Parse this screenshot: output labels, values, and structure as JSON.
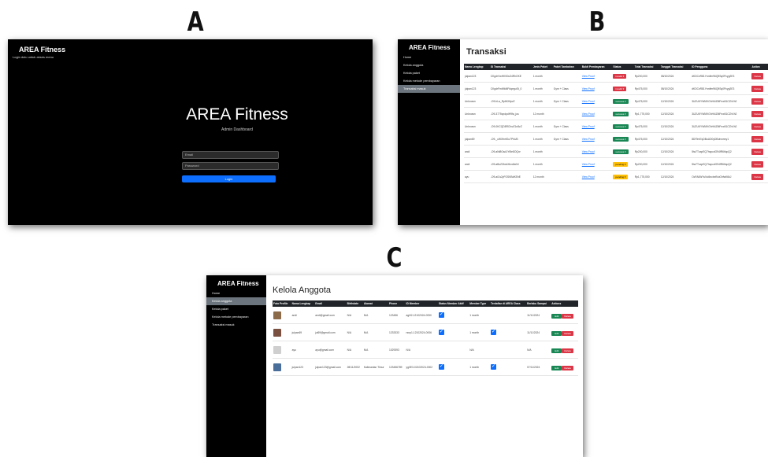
{
  "labels": {
    "a": "A",
    "b": "B",
    "c": "C"
  },
  "login": {
    "brand": "AREA Fitness",
    "subtitle": "Login dulu untuk akses menu",
    "big_title": "AREA Fitness",
    "dashboard": "Admin Dashboard",
    "email_placeholder": "Email",
    "password_placeholder": "Password",
    "login_label": "Login"
  },
  "sidebar": {
    "brand": "AREA Fitness",
    "items": [
      "Home",
      "Kelola anggota",
      "Kelola paket",
      "Kelola metode pembayaran",
      "Transaksi masuk"
    ]
  },
  "transaksi": {
    "title": "Transaksi",
    "columns": [
      "Nama Lengkap",
      "ID Transaksi",
      "Jenis Paket",
      "Paket Tambahan",
      "Bukti Pembayaran",
      "Status",
      "Total Transaksi",
      "Tanggal Transaksi",
      "ID Pengguna",
      "Action"
    ],
    "rows": [
      {
        "nama": "julpan123",
        "id": "CKgdrVwHKS0u34RhOKE",
        "paket": "1 month",
        "tambahan": "",
        "bukti": "View Proof",
        "status": "invalid",
        "total": "Rp200,000",
        "tanggal": "08/10/2024",
        "uid": "dKDCxR81Yrvdfm96Q9Sq0Pcyg2E3",
        "action": "Delete"
      },
      {
        "nama": "julpan123",
        "id": "CKgdrFmWkMFdqeguSt_0",
        "paket": "1 month",
        "tambahan": "Gym + Class",
        "bukti": "View Proof",
        "status": "invalid",
        "total": "Rp475,000",
        "tanggal": "08/10/2024",
        "uid": "dKDCxR81Yrvdfm96Q9Sq0Pcyg2E3",
        "action": "Delete"
      },
      {
        "nama": "Unknown",
        "id": "-O9-hLa_Rp6KHlpvZ",
        "paket": "1 month",
        "tambahan": "Gym + Class",
        "bukti": "View Proof",
        "status": "success",
        "total": "Rp475,000",
        "tanggal": "12/10/2024",
        "uid": "3UZUKYWMXGhHi4ZMFnw51CZhXh2",
        "action": "Delete"
      },
      {
        "nama": "Unknown",
        "id": "-O9-3775vpdpdH9fa_jus",
        "paket": "12 month",
        "tambahan": "",
        "bukti": "View Proof",
        "status": "success",
        "total": "Rp1,775,000",
        "tanggal": "12/10/2024",
        "uid": "3UZUKYWMXGhHi4ZMFnw51CZhXh2",
        "action": "Delete"
      },
      {
        "nama": "Unknown",
        "id": "-O9-0KCQD8RCfxvZ1n8zZ",
        "paket": "1 month",
        "tambahan": "Gym + Class",
        "bukti": "View Proof",
        "status": "success",
        "total": "Rp475,000",
        "tanggal": "12/10/2024",
        "uid": "3UZUKYWMXGhHi4ZMFnw51CZhXh2",
        "action": "Delete"
      },
      {
        "nama": "julpan69",
        "id": "-O9-_cWXfnrfGc7PhUB",
        "paket": "1 month",
        "tambahan": "Gym + Class",
        "bukti": "View Proof",
        "status": "success",
        "total": "Rp475,000",
        "tanggal": "12/10/2024",
        "uid": "8DfTeb7qDBuUD0yDBotvnmry1",
        "action": "Delete"
      },
      {
        "nama": "andi",
        "id": "-O9-aNt8Gsd1Yt5e8OQxr",
        "paket": "1 month",
        "tambahan": "",
        "bukti": "View Proof",
        "status": "success",
        "total": "Rp200,000",
        "tanggal": "12/10/2024",
        "uid": "5iw7TuxpEQ7hspcdO94fR6ifupQ2",
        "action": "Delete"
      },
      {
        "nama": "andi",
        "id": "-O9-aBcZZbxkXbxdbxNI",
        "paket": "1 month",
        "tambahan": "",
        "bukti": "View Proof",
        "status": "pending",
        "total": "Rp200,000",
        "tanggal": "12/10/2024",
        "uid": "5iw7TuxpEQ7hspcdO94fR6ifupQ2",
        "action": "Delete"
      },
      {
        "nama": "ayu",
        "id": "-O9-aiCs2yFOSKBdKEbE",
        "paket": "12 month",
        "tambahan": "",
        "bukti": "View Proof",
        "status": "pending",
        "total": "Rp1,775,000",
        "tanggal": "12/10/2024",
        "uid": "OcFA6WYuNo5ncbxfNoGhfwK6kJ",
        "action": "Delete"
      }
    ]
  },
  "anggota": {
    "title": "Kelola Anggota",
    "columns": [
      "Foto Profile",
      "Nama Lengkap",
      "Email",
      "Birthdate",
      "Alamat",
      "Phone",
      "ID Member",
      "Status Member Aktif",
      "Member Type",
      "Terdaftar di AREA Class",
      "Berlaku Sampai",
      "Actions"
    ],
    "edit_label": "Edit",
    "delete_label": "Delete",
    "rows": [
      {
        "nama": "andi",
        "email": "andi@gmail.com",
        "birth": "N/A",
        "alamat": "N/A",
        "phone": "123456",
        "member_id": "agi02-12102024-0050",
        "aktif": true,
        "type": "1 month",
        "area_class": false,
        "sampai": "11/11/2024",
        "avatar": "#8b6b4a"
      },
      {
        "nama": "julpan69",
        "email": "jul69@gmail.com",
        "birth": "N/A",
        "alamat": "N/A",
        "phone": "1233333",
        "member_id": "rsnp1-12102024-0006",
        "aktif": true,
        "type": "1 month",
        "area_class": true,
        "sampai": "11/11/2024",
        "avatar": "#7a5040"
      },
      {
        "nama": "ayu",
        "email": "ayu@gmail.com",
        "birth": "N/A",
        "alamat": "N/A",
        "phone": "1029393",
        "member_id": "N/A",
        "aktif": false,
        "type": "N/A",
        "area_class": false,
        "sampai": "N/A",
        "avatar": "#cfcfcf"
      },
      {
        "nama": "julpan123",
        "email": "julpan123@gmail.com",
        "birth": "28/11/2002",
        "alamat": "Kalimantan Timur",
        "phone": "123456789",
        "member_id": "yg0E3-02102024-0002",
        "aktif": true,
        "type": "1 month",
        "area_class": true,
        "sampai": "07/11/2024",
        "avatar": "#4a6e9a"
      }
    ]
  }
}
